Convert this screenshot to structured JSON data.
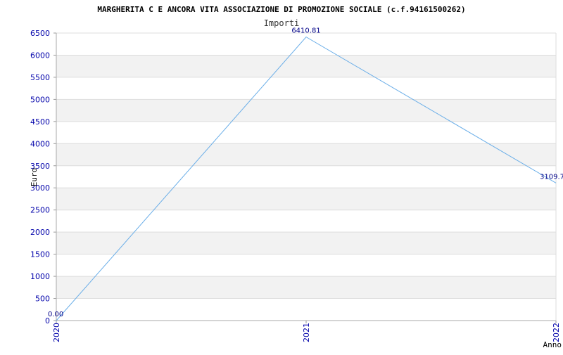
{
  "chart_data": {
    "type": "line",
    "title": "MARGHERITA C E ANCORA VITA ASSOCIAZIONE DI PROMOZIONE SOCIALE (c.f.94161500262)",
    "subtitle": "Importi",
    "xlabel": "Anno",
    "ylabel": "Euro",
    "categories": [
      "2020",
      "2021",
      "2022"
    ],
    "series": [
      {
        "values": [
          0.0,
          6410.81,
          3109.7
        ]
      }
    ],
    "data_labels": [
      "0.00",
      "6410.81",
      "3109.7"
    ],
    "ylim": [
      0,
      6500
    ],
    "yticks": [
      "0",
      "500",
      "1000",
      "1500",
      "2000",
      "2500",
      "3000",
      "3500",
      "4000",
      "4500",
      "5000",
      "5500",
      "6000",
      "6500"
    ],
    "grid": true,
    "colors": {
      "line": "#6aaee8",
      "band": "#f2f2f2",
      "ticks": "#0000aa",
      "data_label": "#000088"
    }
  }
}
